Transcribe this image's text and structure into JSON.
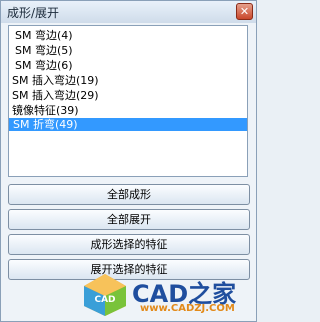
{
  "window": {
    "title": "成形/展开",
    "close_glyph": "✕"
  },
  "list": {
    "items": [
      {
        "label": "SM 弯边(4)",
        "selected": false
      },
      {
        "label": "SM 弯边(5)",
        "selected": false
      },
      {
        "label": "SM 弯边(6)",
        "selected": false
      },
      {
        "label": "SM 插入弯边(19)",
        "selected": false
      },
      {
        "label": "SM 插入弯边(29)",
        "selected": false
      },
      {
        "label": "镜像特征(39)",
        "selected": false
      },
      {
        "label": "SM 折弯(49)",
        "selected": true
      }
    ],
    "selection_color": "#3399ff"
  },
  "buttons": {
    "form_all": "全部成形",
    "unform_all": "全部展开",
    "form_selected": "成形选择的特征",
    "unform_selected": "展开选择的特征"
  },
  "watermark": {
    "logo_letters": "CAD",
    "name": "CAD之家",
    "url": "www.CADZJ.COM"
  }
}
